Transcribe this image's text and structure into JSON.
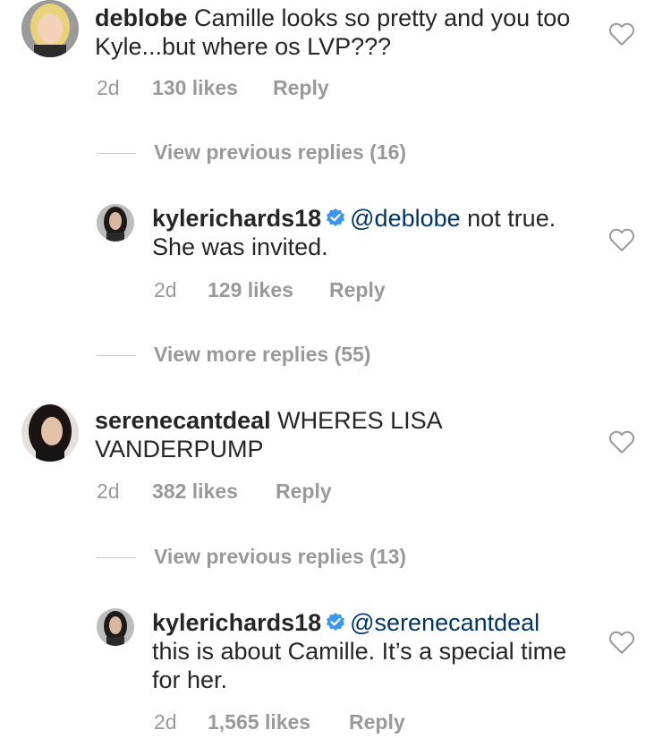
{
  "comments": [
    {
      "username": "deblobe",
      "text": " Camille looks so pretty and you too Kyle...but where os LVP???",
      "time": "2d",
      "likes": "130 likes",
      "reply": "Reply"
    },
    {
      "username": "kylerichards18",
      "mention": "@deblobe",
      "text": " not true. She was invited.",
      "time": "2d",
      "likes": "129 likes",
      "reply": "Reply"
    },
    {
      "username": "serenecantdeal",
      "text": " WHERES LISA VANDERPUMP",
      "time": "2d",
      "likes": "382 likes",
      "reply": "Reply"
    },
    {
      "username": "kylerichards18",
      "mention": "@serenecantdeal",
      "text": " this is about Camille. It’s a special time for her.",
      "time": "2d",
      "likes": "1,565 likes",
      "reply": "Reply"
    }
  ],
  "view_replies": [
    "View previous replies (16)",
    "View more replies (55)",
    "View previous replies (13)"
  ],
  "colors": {
    "verified": "#3897f0",
    "mention": "#003569",
    "meta": "#999999"
  },
  "icons": {
    "like": "heart-icon",
    "verified": "verified-badge-icon"
  }
}
